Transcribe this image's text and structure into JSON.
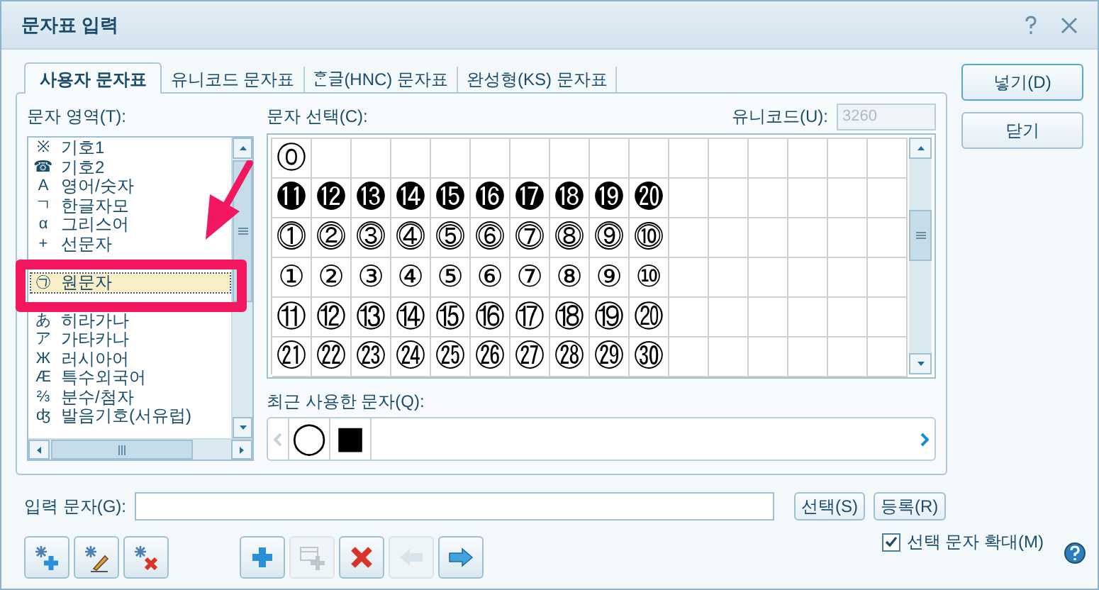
{
  "window": {
    "title": "문자표 입력"
  },
  "tabs": [
    {
      "label": "사용자 문자표",
      "selected": true
    },
    {
      "label": "유니코드 문자표",
      "selected": false
    },
    {
      "label": "ᄒᆞᆫ글(HNC) 문자표",
      "selected": false
    },
    {
      "label": "완성형(KS) 문자표",
      "selected": false
    }
  ],
  "side_buttons": [
    "넣기(D)",
    "닫기"
  ],
  "area": {
    "label": "문자 영역(T):",
    "items": [
      {
        "symbol": "※",
        "label": "기호1",
        "selected": false
      },
      {
        "symbol": "☎",
        "label": "기호2",
        "selected": false
      },
      {
        "symbol": "A",
        "label": "영어/숫자",
        "selected": false
      },
      {
        "symbol": "ㄱ",
        "label": "한글자모",
        "selected": false
      },
      {
        "symbol": "α",
        "label": "그리스어",
        "selected": false
      },
      {
        "symbol": "+",
        "label": "선문자",
        "selected": false
      },
      {
        "symbol": "㉠",
        "label": "원문자",
        "selected": true
      },
      {
        "symbol": "あ",
        "label": "히라가나",
        "selected": false
      },
      {
        "symbol": "ア",
        "label": "가타카나",
        "selected": false
      },
      {
        "symbol": "Ж",
        "label": "러시아어",
        "selected": false
      },
      {
        "symbol": "Æ",
        "label": "특수외국어",
        "selected": false
      },
      {
        "symbol": "⅔",
        "label": "분수/첨자",
        "selected": false
      },
      {
        "symbol": "ʤ",
        "label": "발음기호(서유럽)",
        "selected": false
      }
    ]
  },
  "select": {
    "label": "문자 선택(C):",
    "unicode_label": "유니코드(U):",
    "unicode_value": "3260",
    "rows": [
      [
        "⓪"
      ],
      [
        "⓫",
        "⓬",
        "⓭",
        "⓮",
        "⓯",
        "⓰",
        "⓱",
        "⓲",
        "⓳",
        "⓴"
      ],
      [
        "⓵",
        "⓶",
        "⓷",
        "⓸",
        "⓹",
        "⓺",
        "⓻",
        "⓼",
        "⓽",
        "⓾"
      ],
      [
        "①",
        "②",
        "③",
        "④",
        "⑤",
        "⑥",
        "⑦",
        "⑧",
        "⑨",
        "⑩"
      ],
      [
        "⑪",
        "⑫",
        "⑬",
        "⑭",
        "⑮",
        "⑯",
        "⑰",
        "⑱",
        "⑲",
        "⑳"
      ],
      [
        "㉑",
        "㉒",
        "㉓",
        "㉔",
        "㉕",
        "㉖",
        "㉗",
        "㉘",
        "㉙",
        "㉚"
      ]
    ]
  },
  "recent": {
    "label": "최근 사용한 문자(Q):",
    "chars": [
      "◯",
      "■"
    ]
  },
  "input": {
    "label": "입력 문자(G):",
    "buttons": [
      "선택(S)",
      "등록(R)"
    ]
  },
  "toolbar": [
    {
      "kind": "set-add",
      "disabled": false
    },
    {
      "kind": "set-edit",
      "disabled": false
    },
    {
      "kind": "set-delete",
      "disabled": false
    },
    {
      "kind": "add",
      "disabled": false
    },
    {
      "kind": "copy-add",
      "disabled": true
    },
    {
      "kind": "delete",
      "disabled": false
    },
    {
      "kind": "left",
      "disabled": true
    },
    {
      "kind": "right",
      "disabled": false
    }
  ],
  "enlarge": {
    "label": "선택 문자 확대(M)",
    "checked": true
  }
}
